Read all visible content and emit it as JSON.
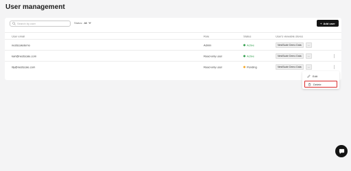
{
  "page": {
    "title": "User management"
  },
  "toolbar": {
    "search_placeholder": "Search by user",
    "status_label": "Status:",
    "status_value": "All",
    "add_user_label": "Add user"
  },
  "table": {
    "headers": {
      "email": "User email",
      "role": "Role",
      "status": "Status",
      "stores": "User's viewable stores"
    },
    "rows": [
      {
        "email": "nestscaledemo",
        "role": "Admin",
        "status": "Active",
        "store": "NestScale Demo Data",
        "more": "..."
      },
      {
        "email": "karl@nestscale.com",
        "role": "Read-only user",
        "status": "Active",
        "store": "NestScale Demo Data",
        "more": "..."
      },
      {
        "email": "lily@nestscale.com",
        "role": "Read-only user",
        "status": "Pending",
        "store": "NestScale Demo Data",
        "more": "..."
      }
    ]
  },
  "context_menu": {
    "edit_label": "Edit",
    "delete_label": "Delete"
  },
  "colors": {
    "active": "#2e9e4a",
    "pending": "#f5a623",
    "delete_highlight": "#d92a2a",
    "primary_button": "#141414"
  },
  "icons": {
    "search": "search-icon",
    "add": "plus-icon",
    "edit": "pencil-icon",
    "delete": "trash-icon",
    "chat": "chat-icon"
  }
}
